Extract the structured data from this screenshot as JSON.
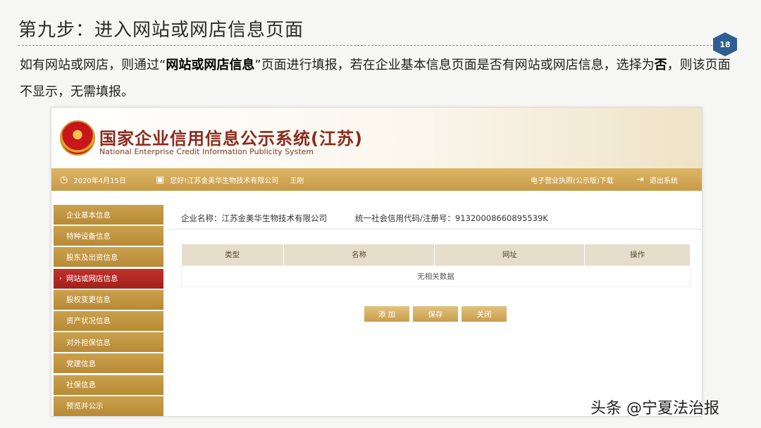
{
  "slide": {
    "title": "第九步：进入网站或网店信息页面",
    "page_number": "18",
    "desc_prefix": "如有网站或网店，则通过“",
    "desc_bold1": "网站或网店信息",
    "desc_mid": "”页面进行填报，若在企业基本信息页面是否有网站或网店信息，选择为",
    "desc_bold2": "否",
    "desc_suffix": "，则该页面不显示，无需填报。"
  },
  "site": {
    "title_cn": "国家企业信用信息公示系统(江苏)",
    "title_en": "National Enterprise Credit Information Publicity System",
    "date": "2020年4月15日",
    "greeting": "您好!江苏金美华生物技术有限公司",
    "user": "王刚",
    "license_link": "电子营业执照(公示版)下载",
    "logout": "退出系统"
  },
  "sidebar": {
    "items": [
      {
        "label": "企业基本信息"
      },
      {
        "label": "特种设备信息"
      },
      {
        "label": "股东及出资信息"
      },
      {
        "label": "网站或网店信息"
      },
      {
        "label": "股权变更信息"
      },
      {
        "label": "资产状况信息"
      },
      {
        "label": "对外担保信息"
      },
      {
        "label": "党建信息"
      },
      {
        "label": "社保信息"
      },
      {
        "label": "预览并公示"
      }
    ],
    "active_index": 3
  },
  "main": {
    "company_label": "企业名称：江苏金美华生物技术有限公司",
    "code_label": "统一社会信用代码/注册号：91320008660895539K",
    "table": {
      "headers": [
        "类型",
        "名称",
        "网址",
        "操作"
      ],
      "empty_text": "无相关数据"
    },
    "buttons": {
      "add": "添 加",
      "save": "保存",
      "close": "关闭"
    }
  },
  "watermark": "头条 @宁夏法治报",
  "colors": {
    "accent_gold": "#c89a48",
    "active_red": "#b0261f",
    "badge_blue": "#2f5e95"
  }
}
